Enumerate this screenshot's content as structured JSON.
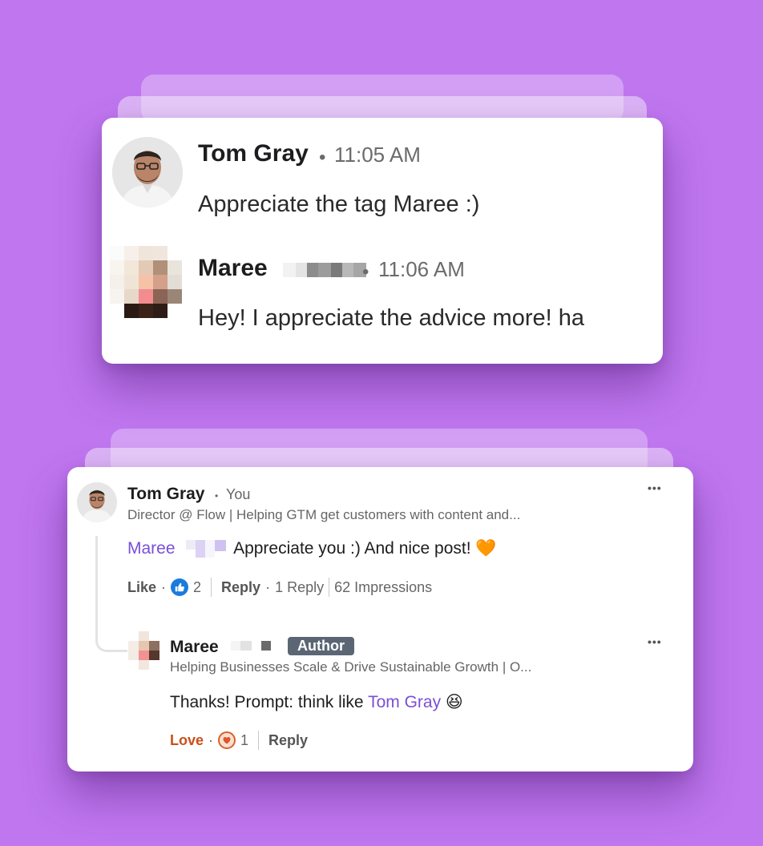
{
  "messages": [
    {
      "name": "Tom Gray",
      "time": "11:05 AM",
      "text": "Appreciate the tag Maree :)"
    },
    {
      "name": "Maree",
      "time": "11:06 AM",
      "text": "Hey! I appreciate the advice more! ha"
    }
  ],
  "comment": {
    "author": "Tom Gray",
    "you_label": "You",
    "headline": "Director @ Flow | Helping GTM get customers with content and...",
    "mention": "Maree",
    "text": "Appreciate you :) And nice post! 🧡",
    "like_label": "Like",
    "like_count": "2",
    "reply_label": "Reply",
    "replies": "1 Reply",
    "impressions": "62 Impressions",
    "more_icon": "•••"
  },
  "reply": {
    "author": "Maree",
    "badge": "Author",
    "headline": "Helping Businesses Scale & Drive Sustainable Growth | O...",
    "text_prefix": "Thanks! Prompt: think like ",
    "mention": "Tom Gray",
    "emoji": "😆",
    "love_label": "Love",
    "love_count": "1",
    "reply_label": "Reply",
    "more_icon": "•••"
  },
  "colors": {
    "background": "#bf76ef",
    "mention": "#7b4fd6",
    "love": "#c8501c",
    "like_icon": "#1a7bdc",
    "badge": "#5b6675"
  },
  "icons": [
    "thumbs-up-icon",
    "heart-icon",
    "more-icon"
  ],
  "separators": {
    "dot": "•",
    "middot": "·"
  }
}
